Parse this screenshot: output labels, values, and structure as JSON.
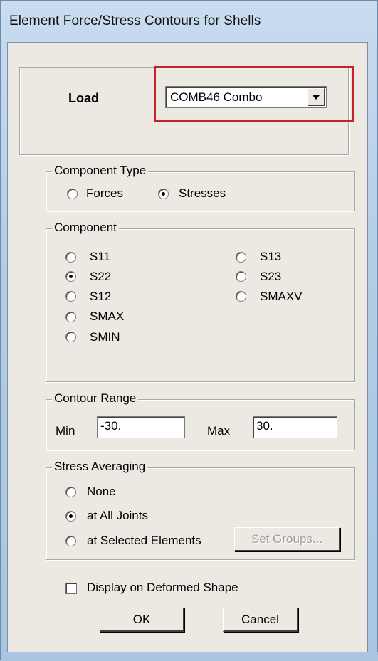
{
  "window": {
    "title": "Element Force/Stress Contours for Shells"
  },
  "load": {
    "label": "Load",
    "selected": "COMB46 Combo"
  },
  "component_type": {
    "legend": "Component Type",
    "options": [
      {
        "label": "Forces",
        "checked": false
      },
      {
        "label": "Stresses",
        "checked": true
      }
    ]
  },
  "component": {
    "legend": "Component",
    "options": [
      {
        "label": "S11",
        "checked": false
      },
      {
        "label": "S22",
        "checked": true
      },
      {
        "label": "S12",
        "checked": false
      },
      {
        "label": "SMAX",
        "checked": false
      },
      {
        "label": "SMIN",
        "checked": false
      },
      {
        "label": "S13",
        "checked": false
      },
      {
        "label": "S23",
        "checked": false
      },
      {
        "label": "SMAXV",
        "checked": false
      }
    ]
  },
  "contour_range": {
    "legend": "Contour Range",
    "min_label": "Min",
    "min_value": "-30.",
    "max_label": "Max",
    "max_value": "30."
  },
  "stress_averaging": {
    "legend": "Stress Averaging",
    "options": [
      {
        "label": "None",
        "checked": false
      },
      {
        "label": "at All Joints",
        "checked": true
      },
      {
        "label": "at Selected Elements",
        "checked": false
      }
    ],
    "set_groups_label": "Set Groups..."
  },
  "display_deformed": {
    "label": "Display on Deformed Shape",
    "checked": false
  },
  "buttons": {
    "ok": "OK",
    "cancel": "Cancel"
  },
  "colors": {
    "highlight": "#c8202a",
    "dialog_bg": "#ece9e3"
  }
}
